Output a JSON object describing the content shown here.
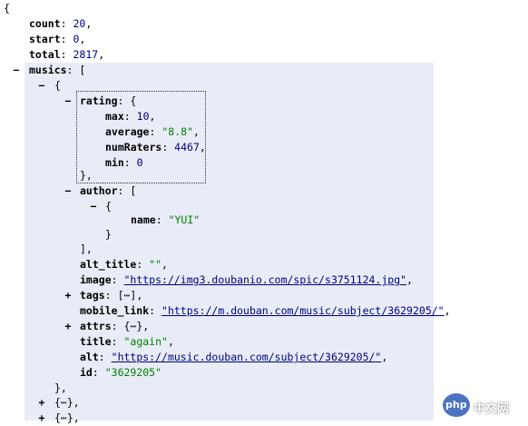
{
  "brace_open": "{",
  "count": {
    "key": "count",
    "value": "20"
  },
  "start": {
    "key": "start",
    "value": "0"
  },
  "total": {
    "key": "total",
    "value": "2817"
  },
  "musics": {
    "key": "musics",
    "open": "["
  },
  "item0": {
    "open": "{",
    "rating": {
      "key": "rating",
      "open": "{",
      "max": {
        "key": "max",
        "value": "10"
      },
      "average": {
        "key": "average",
        "value": "\"8.8\""
      },
      "numRaters": {
        "key": "numRaters",
        "value": "4467"
      },
      "min": {
        "key": "min",
        "value": "0"
      },
      "close": "},"
    },
    "author": {
      "key": "author",
      "open": "[",
      "item_open": "{",
      "name": {
        "key": "name",
        "value": "\"YUI\""
      },
      "item_close": "}",
      "close": "],"
    },
    "alt_title": {
      "key": "alt_title",
      "value": "\"\""
    },
    "image": {
      "key": "image",
      "value": "\"https://img3.doubanio.com/spic/s3751124.jpg\""
    },
    "tags": {
      "key": "tags",
      "value": "[⋯],"
    },
    "mobile_link": {
      "key": "mobile_link",
      "value": "\"https://m.douban.com/music/subject/3629205/\""
    },
    "attrs": {
      "key": "attrs",
      "value": "{⋯},"
    },
    "title": {
      "key": "title",
      "value": "\"again\""
    },
    "alt": {
      "key": "alt",
      "value": "\"https://music.douban.com/subject/3629205/\""
    },
    "id": {
      "key": "id",
      "value": "\"3629205\""
    },
    "close": "},"
  },
  "collapsed_items": [
    "{⋯},",
    "{⋯},"
  ],
  "toggles": {
    "minus": "−",
    "plus": "+"
  },
  "watermark": {
    "brand": "php",
    "text": "中文网",
    "color": "#4a74c0"
  },
  "colors": {
    "number": "#000080",
    "string": "#008000",
    "highlight": "#e8ecf6"
  }
}
